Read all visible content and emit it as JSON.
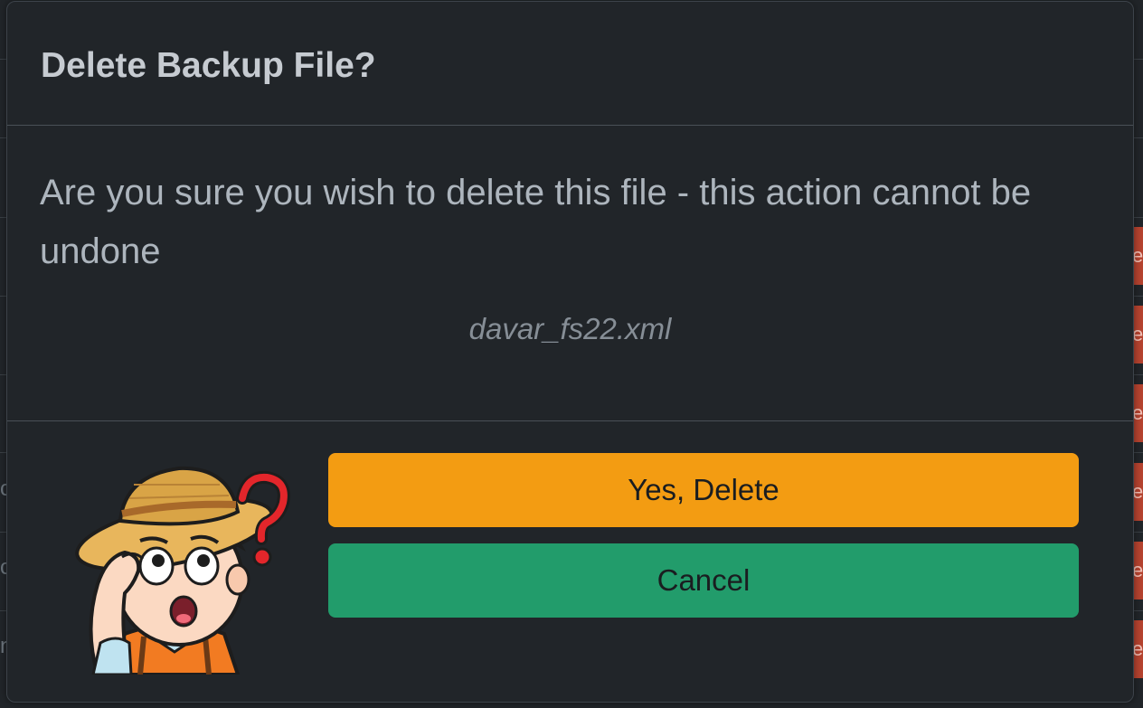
{
  "dialog": {
    "title": "Delete Backup File?",
    "message": "Are you sure you wish to delete this file - this action cannot be undone",
    "file_name": "davar_fs22.xml",
    "confirm_label": "Yes, Delete",
    "cancel_label": "Cancel",
    "mascot_icon": "confused-farmer-icon"
  },
  "background": {
    "row_button_glyph": "e",
    "left_glyphs": [
      "c",
      "c",
      "n"
    ]
  },
  "colors": {
    "confirm_button": "#f39c12",
    "cancel_button": "#229c6b",
    "modal_background": "#212529",
    "background_row_button": "#b5432f"
  }
}
